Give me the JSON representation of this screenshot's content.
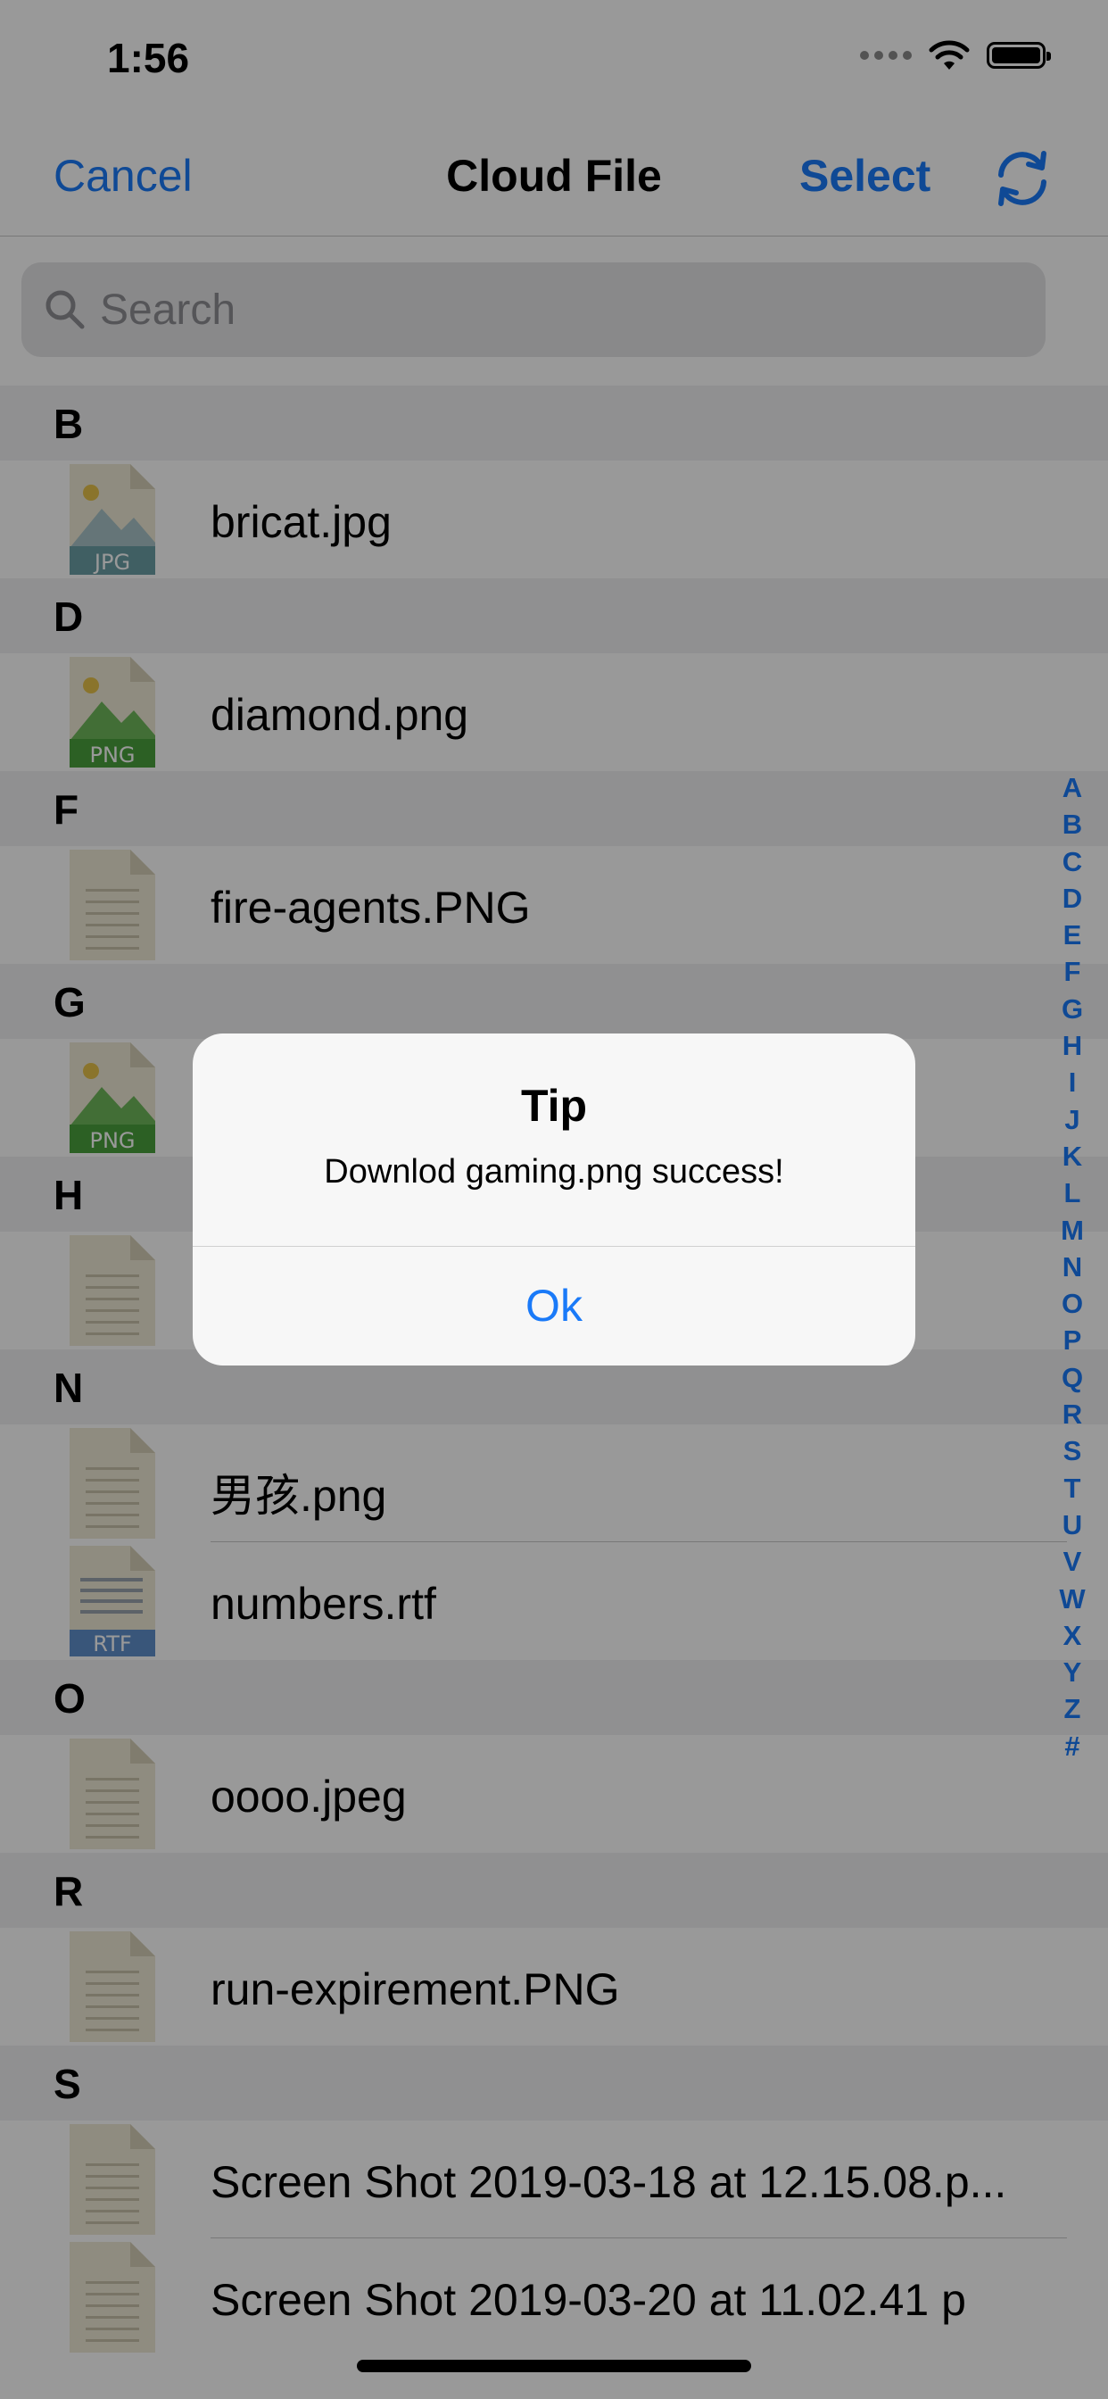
{
  "status": {
    "time": "1:56"
  },
  "nav": {
    "cancel": "Cancel",
    "title": "Cloud File",
    "select": "Select",
    "refresh_icon": "refresh-icon"
  },
  "search": {
    "placeholder": "Search"
  },
  "sections": [
    {
      "letter": "B",
      "files": [
        {
          "name": "bricat.jpg",
          "icon": "jpg"
        }
      ]
    },
    {
      "letter": "D",
      "files": [
        {
          "name": "diamond.png",
          "icon": "png"
        }
      ]
    },
    {
      "letter": "F",
      "files": [
        {
          "name": "fire-agents.PNG",
          "icon": "doc"
        }
      ]
    },
    {
      "letter": "G",
      "files": [
        {
          "name": "",
          "icon": "png"
        }
      ]
    },
    {
      "letter": "H",
      "files": [
        {
          "name": "",
          "icon": "doc"
        }
      ]
    },
    {
      "letter": "N",
      "files": [
        {
          "name": "男孩.png",
          "icon": "doc"
        },
        {
          "name": "numbers.rtf",
          "icon": "rtf"
        }
      ]
    },
    {
      "letter": "O",
      "files": [
        {
          "name": "oooo.jpeg",
          "icon": "doc"
        }
      ]
    },
    {
      "letter": "R",
      "files": [
        {
          "name": "run-expirement.PNG",
          "icon": "doc"
        }
      ]
    },
    {
      "letter": "S",
      "files": [
        {
          "name": "Screen Shot 2019-03-18 at 12.15.08.p...",
          "icon": "doc"
        },
        {
          "name": "Screen Shot 2019-03-20 at 11.02.41 p",
          "icon": "doc"
        }
      ]
    }
  ],
  "index": [
    "A",
    "B",
    "C",
    "D",
    "E",
    "F",
    "G",
    "H",
    "I",
    "J",
    "K",
    "L",
    "M",
    "N",
    "O",
    "P",
    "Q",
    "R",
    "S",
    "T",
    "U",
    "V",
    "W",
    "X",
    "Y",
    "Z",
    "#"
  ],
  "alert": {
    "title": "Tip",
    "message": "Downlod gaming.png success!",
    "ok": "Ok"
  },
  "colors": {
    "accent": "#1a7af8",
    "png_green": "#4aa03c",
    "jpg_teal": "#6c9fa6",
    "rtf_blue": "#5f8fcc",
    "doc_beige": "#efe9d6"
  }
}
